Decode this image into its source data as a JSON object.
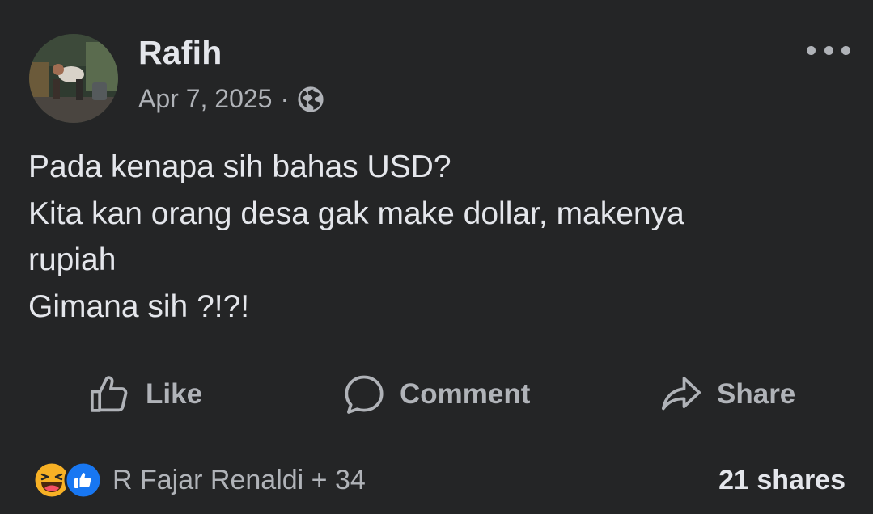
{
  "post": {
    "author": "Rafih",
    "date": "Apr 7, 2025",
    "separator": "·",
    "privacy_icon": "globe-icon",
    "more_icon": "more-options-icon",
    "text_lines": [
      "Pada kenapa sih bahas USD?",
      "Kita kan orang desa gak make dollar, makenya",
      "rupiah",
      "Gimana sih ?!?!"
    ]
  },
  "actions": {
    "like_label": "Like",
    "comment_label": "Comment",
    "share_label": "Share"
  },
  "footer": {
    "reaction_icons": [
      "haha-reaction-icon",
      "like-reaction-icon"
    ],
    "reactors": "R Fajar Renaldi + 34",
    "shares": "21 shares"
  },
  "colors": {
    "background": "#242526",
    "primary_text": "#e4e6eb",
    "secondary_text": "#b0b3b8",
    "like_blue": "#1877f2",
    "haha_yellow": "#f7b125"
  }
}
